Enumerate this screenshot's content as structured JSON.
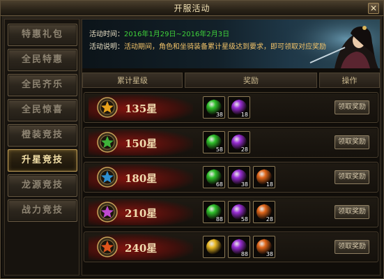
{
  "window": {
    "title": "开服活动",
    "close_label": "✕"
  },
  "sidebar": {
    "items": [
      {
        "label": "特惠礼包"
      },
      {
        "label": "全民特惠"
      },
      {
        "label": "全民齐乐"
      },
      {
        "label": "全民惊喜"
      },
      {
        "label": "橙装竞技"
      },
      {
        "label": "升星竞技",
        "active": true
      },
      {
        "label": "龙源竞技"
      },
      {
        "label": "战力竞技"
      }
    ]
  },
  "banner": {
    "time_label": "活动时间：",
    "time_value": "2016年1月29日~2016年2月3日",
    "desc_label": "活动说明：",
    "desc_value": "活动期间，角色和坐骑装备累计星级达到要求，即可领取对应奖励"
  },
  "table": {
    "headers": [
      "累计星级",
      "奖励",
      "操作"
    ],
    "rows": [
      {
        "stars": "135星",
        "medal_color": "#e8a21c",
        "items": [
          {
            "icon": "green-orb",
            "count": "38"
          },
          {
            "icon": "purple-orb",
            "count": "18"
          }
        ],
        "button": "领取奖励"
      },
      {
        "stars": "150星",
        "medal_color": "#3fb33a",
        "items": [
          {
            "icon": "green-orb",
            "count": "58"
          },
          {
            "icon": "purple-orb",
            "count": "28"
          }
        ],
        "button": "领取奖励"
      },
      {
        "stars": "180星",
        "medal_color": "#2e8fd0",
        "items": [
          {
            "icon": "green-orb",
            "count": "68"
          },
          {
            "icon": "purple-orb",
            "count": "38"
          },
          {
            "icon": "orange-orb",
            "count": "18"
          }
        ],
        "button": "领取奖励"
      },
      {
        "stars": "210星",
        "medal_color": "#c04ad0",
        "items": [
          {
            "icon": "green-orb",
            "count": "88"
          },
          {
            "icon": "purple-orb",
            "count": "58"
          },
          {
            "icon": "orange-orb",
            "count": "28"
          }
        ],
        "button": "领取奖励"
      },
      {
        "stars": "240星",
        "medal_color": "#e0541c",
        "items": [
          {
            "icon": "gold-orb",
            "count": ""
          },
          {
            "icon": "purple-orb",
            "count": "88"
          },
          {
            "icon": "orange-orb",
            "count": "38"
          }
        ],
        "button": "领取奖励"
      }
    ]
  },
  "colors": {
    "green-orb": "#2fc02a",
    "purple-orb": "#9a2fd6",
    "orange-orb": "#e0661a",
    "gold-orb": "#e8b824"
  }
}
